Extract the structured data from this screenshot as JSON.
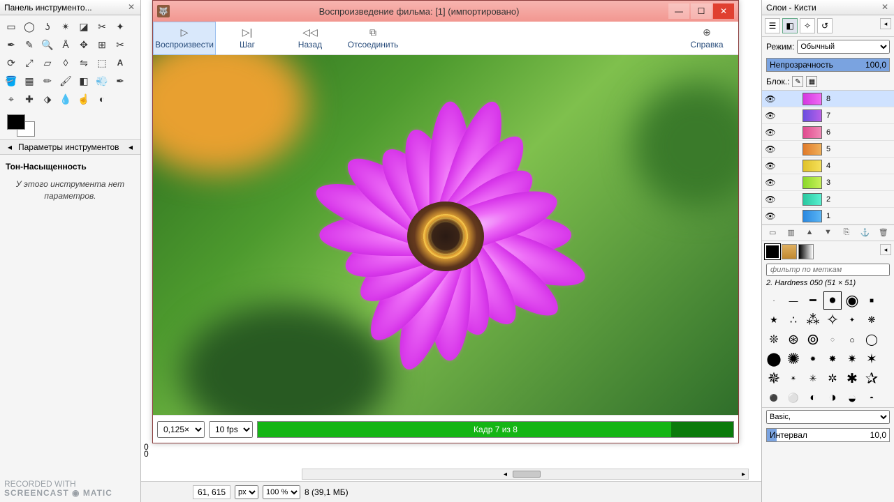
{
  "toolbox": {
    "title": "Панель инструменто...",
    "options_header": "Параметры инструментов",
    "current_tool": "Тон-Насыщенность",
    "no_params": "У этого инструмента нет параметров."
  },
  "playback": {
    "title": "Воспроизведение фильма: [1] (импортировано)",
    "buttons": {
      "play": "Воспроизвести",
      "step": "Шаг",
      "back": "Назад",
      "detach": "Отсоединить",
      "help": "Справка"
    },
    "zoom": "0,125×",
    "fps": "10 fps",
    "frame_label": "Кадр 7 из 8"
  },
  "layers_panel": {
    "title": "Слои - Кисти",
    "mode_label": "Режим:",
    "mode_value": "Обычный",
    "opacity_label": "Непрозрачность",
    "opacity_value": "100,0",
    "lock_label": "Блок.:",
    "layers": [
      {
        "name": "8"
      },
      {
        "name": "7"
      },
      {
        "name": "6"
      },
      {
        "name": "5"
      },
      {
        "name": "4"
      },
      {
        "name": "3"
      },
      {
        "name": "2"
      },
      {
        "name": "1"
      }
    ],
    "brush_filter_placeholder": "фильтр по меткам",
    "brush_name": "2. Hardness 050 (51 × 51)",
    "brush_set": "Basic,",
    "interval_label": "Интервал",
    "interval_value": "10,0"
  },
  "canvas_status": {
    "coords": "61, 615",
    "unit": "px",
    "zoom": "100 %",
    "layer_info": "8 (39,1 МБ)"
  },
  "ruler_marks": {
    "a": "0",
    "b": "0"
  },
  "watermark": {
    "top": "RECORDED WITH",
    "bottom": "SCREENCAST ◉ MATIC"
  },
  "layer_thumb_colors": [
    "linear-gradient(90deg,#d338e0,#f06af5)",
    "linear-gradient(90deg,#6a4fe0,#b85fe8)",
    "linear-gradient(90deg,#e04a8f,#f08ab5)",
    "linear-gradient(90deg,#e07a2a,#f0b05a)",
    "linear-gradient(90deg,#e0c22a,#f5e05a)",
    "linear-gradient(90deg,#8ad82a,#c8f05a)",
    "linear-gradient(90deg,#2ac8a0,#5af0d0)",
    "linear-gradient(90deg,#2a88e0,#5ab5f5)"
  ]
}
